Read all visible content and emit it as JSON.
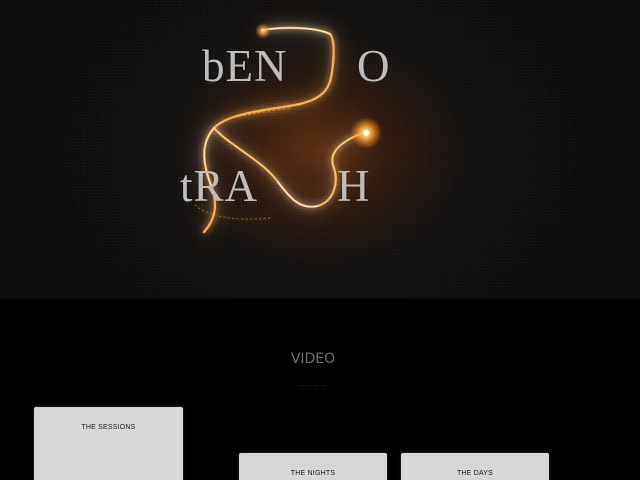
{
  "logo": {
    "line1_left": "bEN",
    "line1_right": "O",
    "line2_left": "tRA",
    "line2_right": "H",
    "glow_color": "#ff9a3c"
  },
  "section": {
    "title": "VIDEO",
    "subtitle": "— — — —"
  },
  "cards": [
    {
      "label": "THE SESSIONS"
    },
    {
      "label": "THE NIGHTS"
    },
    {
      "label": "THE DAYS"
    }
  ]
}
